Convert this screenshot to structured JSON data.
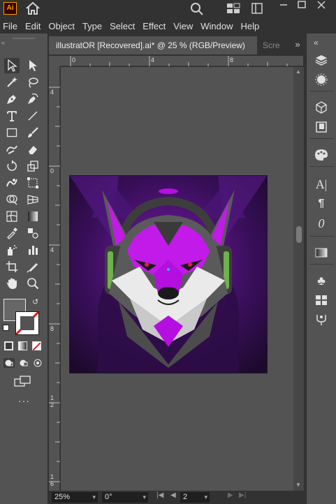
{
  "app": {
    "logo_text": "Ai"
  },
  "menu": [
    "File",
    "Edit",
    "Object",
    "Type",
    "Select",
    "Effect",
    "View",
    "Window",
    "Help"
  ],
  "tabs": {
    "active": "illustratOR [Recovered].ai* @ 25 % (RGB/Preview)",
    "inactive": "Scre"
  },
  "ruler_h": [
    "0",
    "4",
    "8"
  ],
  "ruler_v": [
    "4",
    "0",
    "4",
    "8",
    "1\n2",
    "1\n6"
  ],
  "status": {
    "zoom": "25%",
    "rotation": "0°",
    "artboard": "2"
  },
  "colors": {
    "artboard_bg": "#221130",
    "purple": "#b40fe0",
    "magenta": "#e040ff",
    "gray": "#5a5a5a",
    "green": "#6fb14e"
  },
  "icons": {
    "tools": [
      "selection-tool-icon",
      "direct-selection-tool-icon",
      "magic-wand-icon",
      "lasso-icon",
      "pen-tool-icon",
      "curvature-tool-icon",
      "type-tool-icon",
      "line-tool-icon",
      "rectangle-tool-icon",
      "paintbrush-icon",
      "shaper-tool-icon",
      "eraser-icon",
      "rotate-tool-icon",
      "scale-tool-icon",
      "warp-tool-icon",
      "free-transform-icon",
      "shape-builder-icon",
      "perspective-grid-icon",
      "mesh-tool-icon",
      "gradient-tool-icon",
      "eyedropper-icon",
      "blend-tool-icon",
      "symbol-sprayer-icon",
      "graph-tool-icon",
      "artboard-tool-icon",
      "slice-tool-icon",
      "hand-tool-icon",
      "zoom-tool-icon"
    ],
    "right": [
      "layers-icon",
      "appearance-icon",
      "3d-icon",
      "libraries-icon",
      "color-palette-icon",
      "character-icon",
      "paragraph-icon",
      "opentype-icon",
      "gradient-panel-icon",
      "symbols-icon",
      "align-icon",
      "puppet-warp-icon"
    ]
  }
}
